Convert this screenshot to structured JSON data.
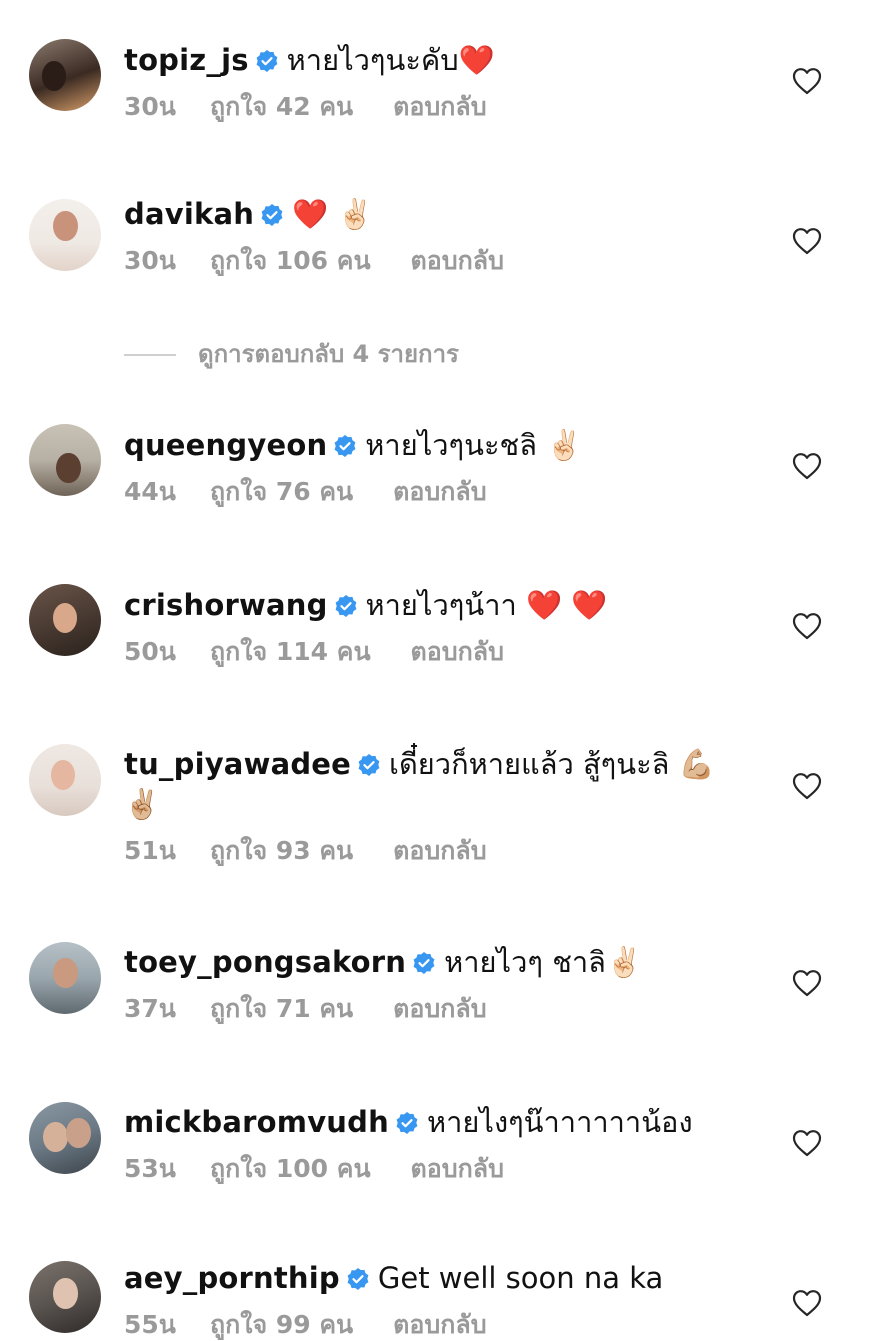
{
  "comments": [
    {
      "username": "topiz_js",
      "text": "หายไวๆนะคับ❤️",
      "time": "30น",
      "likes": "ถูกใจ 42 คน",
      "reply": "ตอบกลับ",
      "verified": true,
      "avatar_colors": [
        "#3a2a22",
        "#d9a06b"
      ]
    },
    {
      "username": "davikah",
      "text": "❤️ ✌🏻",
      "time": "30น",
      "likes": "ถูกใจ 106 คน",
      "reply": "ตอบกลับ",
      "verified": true,
      "avatar_colors": [
        "#efe9e4",
        "#c8927b"
      ]
    },
    {
      "username": "queengyeon",
      "text": "หายไวๆนะชลิ ✌🏻",
      "time": "44น",
      "likes": "ถูกใจ 76 คน",
      "reply": "ตอบกลับ",
      "verified": true,
      "avatar_colors": [
        "#b7b0a4",
        "#6f6357"
      ]
    },
    {
      "username": "crishorwang",
      "text": "หายไวๆน้าา ❤️ ❤️",
      "time": "50น",
      "likes": "ถูกใจ 114 คน",
      "reply": "ตอบกลับ",
      "verified": true,
      "avatar_colors": [
        "#4a3b33",
        "#d9a88b"
      ]
    },
    {
      "username": "tu_piyawadee",
      "text": "เดี๋ยวก็หายแล้ว สู้ๆนะลิ 💪🏼 ✌🏼",
      "time": "51น",
      "likes": "ถูกใจ 93 คน",
      "reply": "ตอบกลับ",
      "verified": true,
      "avatar_colors": [
        "#e8dfd9",
        "#e6b7a0"
      ]
    },
    {
      "username": "toey_pongsakorn",
      "text": "หายไวๆ ชาลิ✌🏻",
      "time": "37น",
      "likes": "ถูกใจ 71 คน",
      "reply": "ตอบกลับ",
      "verified": true,
      "avatar_colors": [
        "#9aa6ad",
        "#2b2b2b"
      ]
    },
    {
      "username": "mickbaromvudh",
      "text": "หายไงๆน๊าาาาาาน้อง",
      "time": "53น",
      "likes": "ถูกใจ 100 คน",
      "reply": "ตอบกลับ",
      "verified": true,
      "avatar_colors": [
        "#6b7a86",
        "#d6b19a"
      ]
    },
    {
      "username": "aey_pornthip",
      "text": "Get well soon na ka",
      "time": "55น",
      "likes": "ถูกใจ 99 คน",
      "reply": "ตอบกลับ",
      "verified": true,
      "avatar_colors": [
        "#5a5450",
        "#e0c2b0"
      ]
    }
  ],
  "view_replies": "ดูการตอบกลับ 4 รายการ",
  "colors": {
    "verified_badge": "#3897f0",
    "meta_text": "#9a9a9a",
    "heart_outline": "#262626"
  },
  "icons": {
    "verified": "verified-badge-icon",
    "like": "heart-outline-icon"
  }
}
